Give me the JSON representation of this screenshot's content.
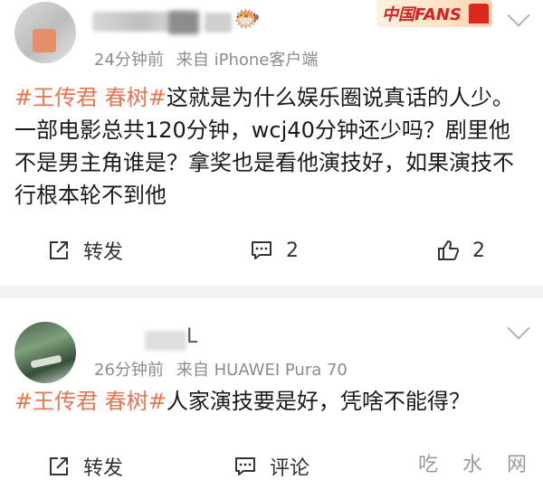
{
  "post1": {
    "name_tail": "",
    "emoji": "🐡",
    "badge": "中国FANS",
    "time": "24分钟前",
    "source": "来自 iPhone客户端",
    "tag": "#王传君 春树#",
    "text": "这就是为什么娱乐圈说真话的人少。一部电影总共120分钟，wcj40分钟还少吗？剧里他不是男主角谁是？拿奖也是看他演技好，如果演技不行根本轮不到他",
    "share_label": "转发",
    "comment_count": "2",
    "like_count": "2"
  },
  "post2": {
    "name_tail": "L",
    "time": "26分钟前",
    "source": "来自 HUAWEI Pura 70",
    "tag": "#王传君 春树#",
    "text": "人家演技要是好，凭啥不能得？",
    "share_label": "转发",
    "comment_label": "评论",
    "watermark": "吃 水 网"
  }
}
